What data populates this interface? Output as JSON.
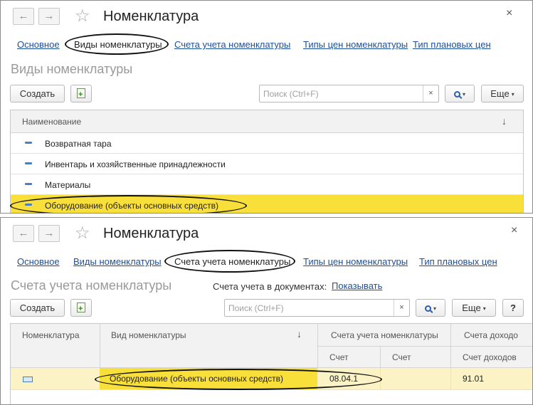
{
  "panel1": {
    "title": "Номенклатура",
    "nav_back": "←",
    "nav_forward": "→",
    "star": "☆",
    "close": "×",
    "tabs": [
      "Основное",
      "Виды номенклатуры",
      "Счета учета номенклатуры",
      "Типы цен номенклатуры",
      "Тип плановых цен"
    ],
    "section_title": "Виды номенклатуры",
    "create_label": "Создать",
    "search_placeholder": "Поиск (Ctrl+F)",
    "search_clear": "×",
    "more_label": "Еще",
    "dropdown_arrow": "▾",
    "column_name": "Наименование",
    "sort_arrow": "↓",
    "rows": [
      "Возвратная тара",
      "Инвентарь и хозяйственные принадлежности",
      "Материалы",
      "Оборудование (объекты основных средств)"
    ]
  },
  "panel2": {
    "title": "Номенклатура",
    "nav_back": "←",
    "nav_forward": "→",
    "star": "☆",
    "close": "×",
    "tabs": [
      "Основное",
      "Виды номенклатуры",
      "Счета учета номенклатуры",
      "Типы цен номенклатуры",
      "Тип плановых цен"
    ],
    "section_title": "Счета учета номенклатуры",
    "docs_label": "Счета учета в документах:",
    "docs_link": "Показывать",
    "create_label": "Создать",
    "search_placeholder": "Поиск (Ctrl+F)",
    "search_clear": "×",
    "more_label": "Еще",
    "dropdown_arrow": "▾",
    "help_label": "?",
    "columns": {
      "nomenclature": "Номенклатура",
      "kind": "Вид номенклатуры",
      "sort_arrow": "↓",
      "accounts_group": "Счета учета номенклатуры",
      "account": "Счет",
      "account2": "Счет",
      "income_group": "Счета доходо",
      "income_account": "Счет доходов"
    },
    "row": {
      "kind": "Оборудование (объекты основных средств)",
      "account": "08.04.1",
      "income": "91.01"
    }
  },
  "colors": {
    "selection": "#f9df3a",
    "link": "#1b4f9c",
    "accent_blue": "#2f5da8"
  }
}
